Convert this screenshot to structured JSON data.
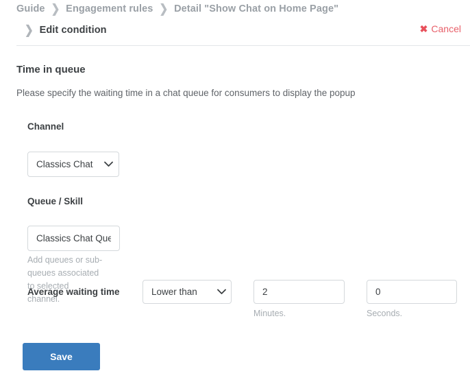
{
  "header": {
    "breadcrumb": [
      {
        "label": "Guide"
      },
      {
        "label": "Engagement rules"
      },
      {
        "label": "Detail \"Show Chat on Home Page\""
      }
    ],
    "separator": "❯",
    "subhead": {
      "chevron": "❯",
      "title": "Edit condition"
    },
    "cancel": {
      "icon": "✖",
      "label": "Cancel",
      "color": "#e8505b"
    }
  },
  "body": {
    "section_title": "Time in queue",
    "section_description": "Please specify the waiting time in a chat queue for consumers to display the popup",
    "fields": {
      "channel": {
        "label": "Channel",
        "value": "Classics Chat",
        "options": [
          "Classics Chat"
        ],
        "caret": "⌄"
      },
      "queue": {
        "label": "Queue / Skill",
        "value": "Classics Chat Queue",
        "placeholder": "",
        "help": "Add queues or sub-queues associated to selected channel."
      },
      "average_waiting_time": {
        "label": "Average waiting time",
        "comparator": {
          "value": "Lower than",
          "options": [
            "Lower than"
          ],
          "caret": "⌄"
        },
        "minutes": {
          "value": "2",
          "help": "Minutes."
        },
        "seconds": {
          "value": "0",
          "help": "Seconds."
        }
      }
    },
    "save_button": {
      "label": "Save",
      "color": "#3a7cbd"
    }
  }
}
